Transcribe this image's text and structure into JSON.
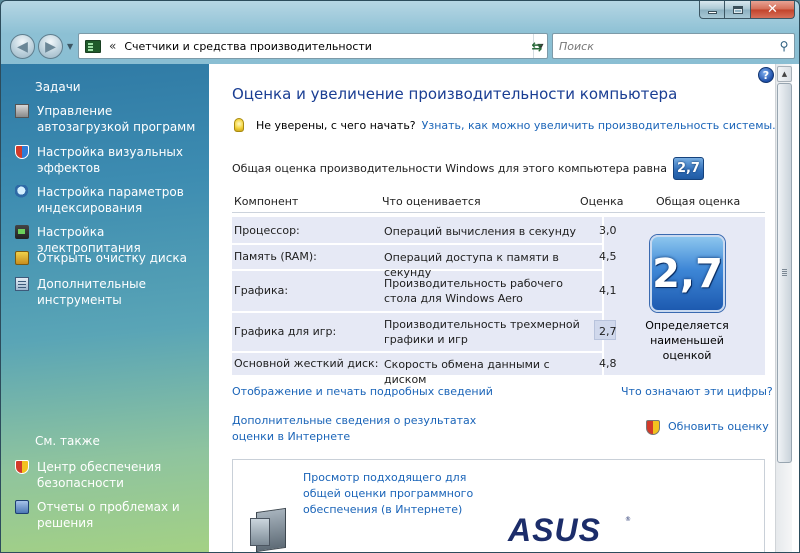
{
  "window": {
    "close_glyph": "✕"
  },
  "nav": {
    "address_separator": "«",
    "address_text": "Счетчики и средства производительности",
    "search_placeholder": "Поиск"
  },
  "sidebar": {
    "tasks_heading": "Задачи",
    "items": [
      {
        "label": "Управление автозагрузкой программ",
        "icon": "startup-icon"
      },
      {
        "label": "Настройка визуальных эффектов",
        "icon": "shield-icon"
      },
      {
        "label": "Настройка параметров индексирования",
        "icon": "index-icon"
      },
      {
        "label": "Настройка электропитания",
        "icon": "power-icon"
      },
      {
        "label": "Открыть очистку диска",
        "icon": "disk-cleanup-icon"
      },
      {
        "label": "Дополнительные инструменты",
        "icon": "tools-icon"
      }
    ],
    "see_also_heading": "См. также",
    "see_also": [
      {
        "label": "Центр обеспечения безопасности",
        "icon": "security-center-icon"
      },
      {
        "label": "Отчеты о проблемах и решения",
        "icon": "problem-reports-icon"
      }
    ]
  },
  "main": {
    "title": "Оценка и увеличение производительности компьютера",
    "tip_text": "Не уверены, с чего начать?",
    "tip_link": "Узнать, как можно увеличить производительность системы.",
    "overall_label": "Общая оценка производительности Windows для этого компьютера равна",
    "overall_score": "2,7",
    "table": {
      "headers": {
        "component": "Компонент",
        "what": "Что оценивается",
        "score": "Оценка",
        "base": "Общая оценка"
      },
      "rows": [
        {
          "component": "Процессор:",
          "what": "Операций вычисления в секунду",
          "score": "3,0"
        },
        {
          "component": "Память (RAM):",
          "what": "Операций доступа к памяти в секунду",
          "score": "4,5"
        },
        {
          "component": "Графика:",
          "what": "Производительность рабочего стола для Windows Aero",
          "score": "4,1"
        },
        {
          "component": "Графика для игр:",
          "what": "Производительность трехмерной графики и игр",
          "score": "2,7"
        },
        {
          "component": "Основной жесткий диск:",
          "what": "Скорость обмена данными с диском",
          "score": "4,8"
        }
      ],
      "base_score": "2,7",
      "base_caption": "Определяется наименьшей оценкой"
    },
    "links": {
      "details": "Отображение и печать подробных сведений",
      "meaning": "Что означают эти цифры?",
      "online_line1": "Дополнительные сведения о результатах",
      "online_line2": "оценки в Интернете",
      "update": "Обновить оценку"
    },
    "software_link": "Просмотр подходящего для общей оценки программного обеспечения (в Интернете)",
    "brand": "ASUS",
    "brand_tm": "®"
  }
}
